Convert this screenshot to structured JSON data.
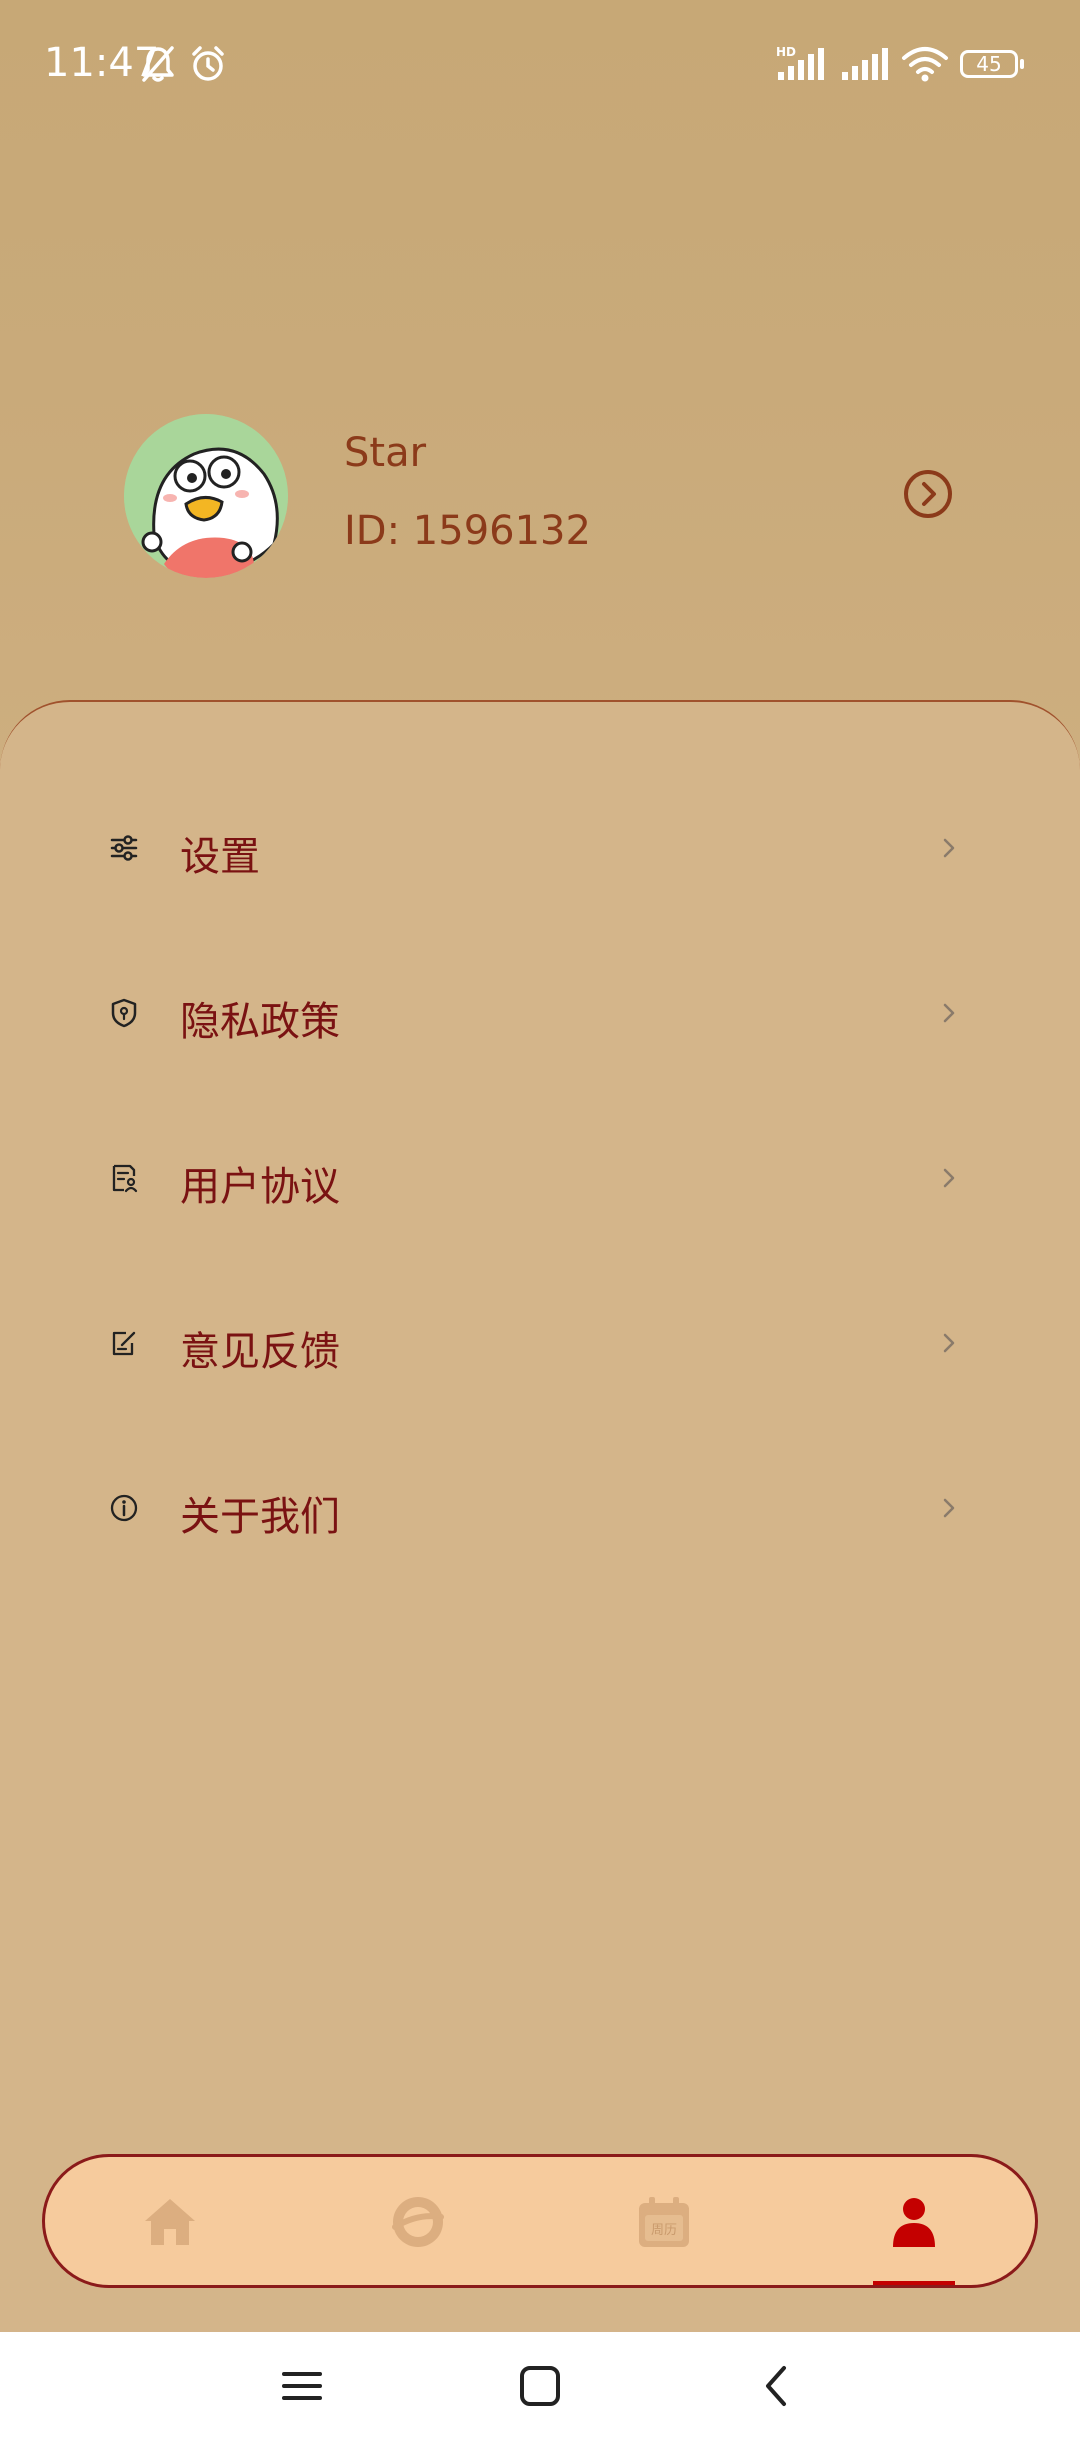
{
  "status_bar": {
    "time": "11:47",
    "battery": "45",
    "icons": [
      "bell-off-icon",
      "alarm-icon",
      "hd-signal-icon",
      "signal-icon",
      "wifi-icon",
      "battery-icon"
    ]
  },
  "profile": {
    "name": "Star",
    "id_text": "ID: 1596132",
    "avatar": "duck-avatar"
  },
  "menu": {
    "items": [
      {
        "label": "设置",
        "icon": "sliders-icon"
      },
      {
        "label": "隐私政策",
        "icon": "shield-icon"
      },
      {
        "label": "用户协议",
        "icon": "document-user-icon"
      },
      {
        "label": "意见反馈",
        "icon": "feedback-edit-icon"
      },
      {
        "label": "关于我们",
        "icon": "info-icon"
      }
    ]
  },
  "bottom_nav": {
    "items": [
      {
        "name": "home",
        "icon": "home-icon",
        "active": false
      },
      {
        "name": "discover",
        "icon": "planet-icon",
        "active": false
      },
      {
        "name": "calendar",
        "icon": "calendar-icon",
        "active": false,
        "badge_text": "周历"
      },
      {
        "name": "profile",
        "icon": "user-icon",
        "active": true
      }
    ]
  },
  "colors": {
    "header_bg": "#c7a876",
    "card_bg": "#d4b58a",
    "menu_text": "#7a1212",
    "profile_text": "#8b3a1a",
    "nav_bg": "#f6cb9d",
    "nav_border": "#8b1a1a",
    "active": "#c40000",
    "inactive_icon": "#d9ab7f"
  }
}
